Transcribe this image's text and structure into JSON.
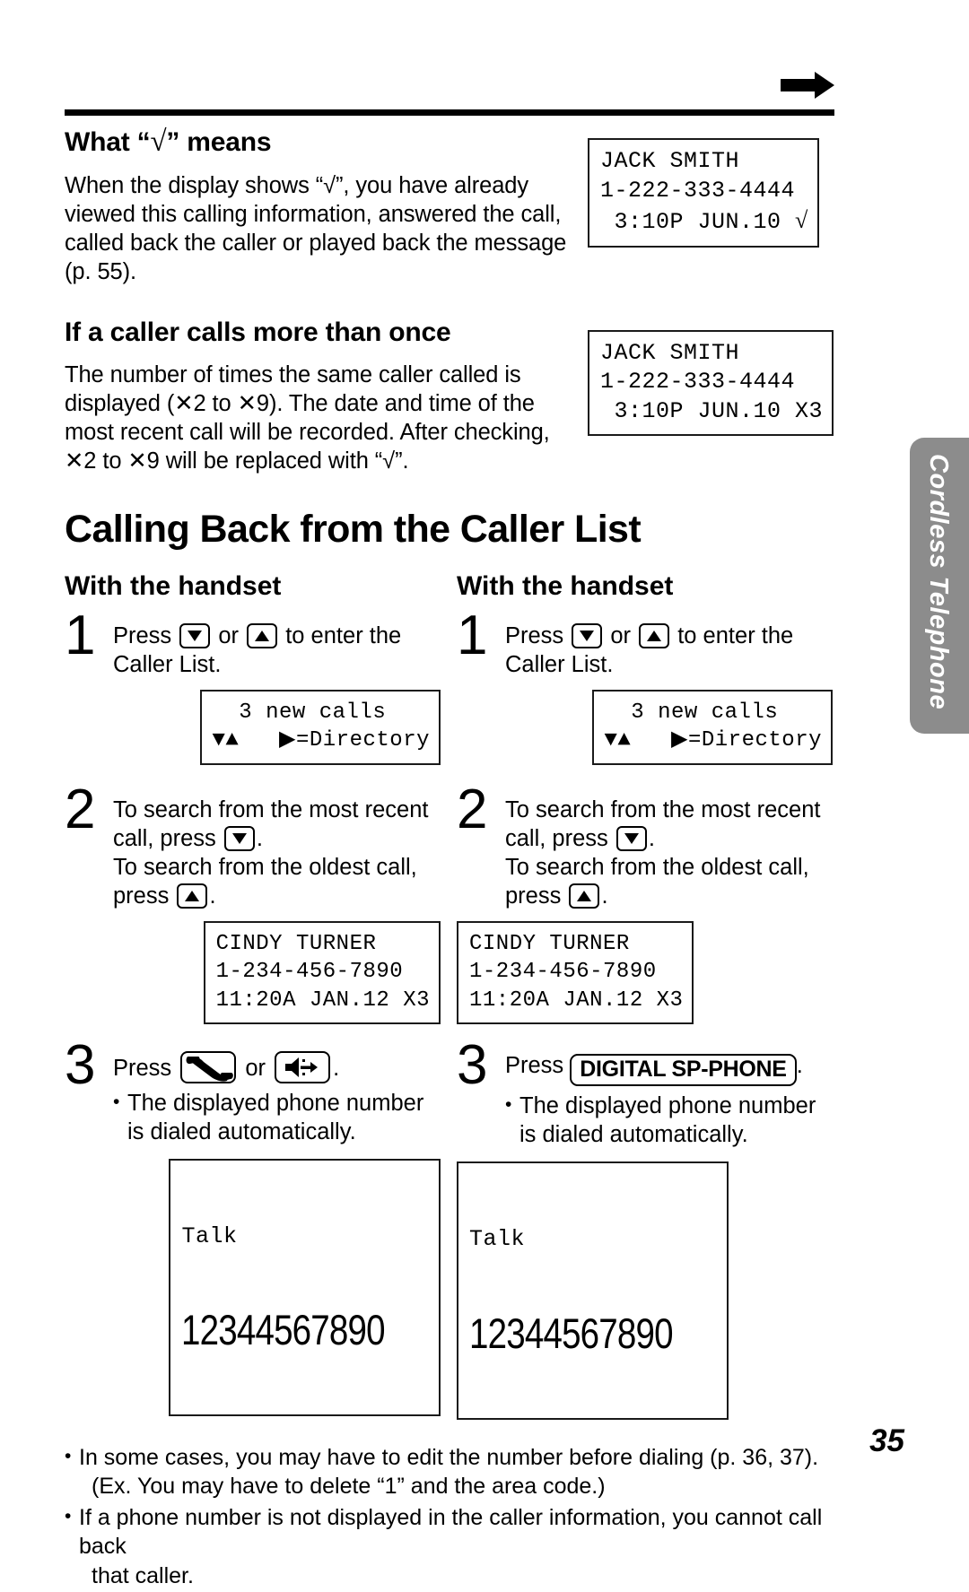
{
  "page": {
    "number": "35",
    "side_tab_label": "Cordless Telephone",
    "arrow_icon": "right-arrow-icon"
  },
  "section_check": {
    "heading_pre": "What “",
    "heading_symbol": "√",
    "heading_post": "” means",
    "body": "When the display shows “√”, you have already viewed this calling information, answered the call, called back the caller or played back the message (p. 55).",
    "lcd": {
      "line1": "JACK SMITH",
      "line2": "1-222-333-4444",
      "line3": " 3:10P JUN.10 ",
      "line3_symbol": "√"
    }
  },
  "section_multiple": {
    "heading": "If a caller calls more than once",
    "body": "The number of times the same caller called is displayed (✕2 to ✕9). The date and time of the most recent call will be recorded. After checking, ✕2 to ✕9 will be replaced with “√”.",
    "lcd": {
      "line1": "JACK SMITH",
      "line2": "1-222-333-4444",
      "line3": " 3:10P JUN.10 X3"
    }
  },
  "main_heading": "Calling Back from the Caller List",
  "columns": [
    {
      "subheading": "With the handset",
      "steps": [
        {
          "num": "1",
          "text_before": "Press ",
          "key1": "down-arrow-key",
          "text_mid": " or ",
          "key2": "up-arrow-key",
          "text_after": " to enter the Caller List.",
          "lcd": {
            "line1": "  3 new calls",
            "line2": "▼▲   ▶=Directory"
          }
        },
        {
          "num": "2",
          "text_before": "To search from the most recent call, press ",
          "key1": "down-arrow-key",
          "text_mid": ".",
          "text_before2": "To search from the oldest call, press ",
          "key2": "up-arrow-key",
          "text_after": ".",
          "lcd": {
            "line1": "CINDY TURNER",
            "line2": "1-234-456-7890",
            "line3": "11:20A JAN.12 X3"
          }
        },
        {
          "num": "3",
          "text_before": "Press ",
          "key1": "handset-key",
          "text_mid": " or ",
          "key2": "speakerphone-key",
          "text_after": ".",
          "bullet": "The displayed phone number is dialed automatically.",
          "lcd": {
            "line1": "Talk",
            "line2": "12344567890"
          }
        }
      ]
    },
    {
      "subheading": "With the handset",
      "steps": [
        {
          "num": "1",
          "text_before": "Press ",
          "key1": "down-arrow-key",
          "text_mid": " or ",
          "key2": "up-arrow-key",
          "text_after": " to enter the Caller List.",
          "lcd": {
            "line1": "  3 new calls",
            "line2": "▼▲   ▶=Directory"
          }
        },
        {
          "num": "2",
          "text_before": "To search from the most recent call, press ",
          "key1": "down-arrow-key",
          "text_mid": ".",
          "text_before2": "To search from the oldest call, press ",
          "key2": "up-arrow-key",
          "text_after": ".",
          "lcd": {
            "line1": "CINDY TURNER",
            "line2": "1-234-456-7890",
            "line3": "11:20A JAN.12 X3"
          }
        },
        {
          "num": "3",
          "text_before": "Press ",
          "button_label": "DIGITAL SP-PHONE",
          "text_after": ".",
          "bullet": "The displayed phone number is dialed automatically.",
          "lcd": {
            "line1": "Talk",
            "line2": "12344567890"
          }
        }
      ]
    }
  ],
  "notes": [
    {
      "text": "In some cases, you may have to edit the number before dialing (p. 36, 37).",
      "cont": "(Ex. You may have to delete “1” and the area code.)"
    },
    {
      "text": "If a phone number is not displayed in the caller information, you cannot call back",
      "cont": "that caller."
    }
  ]
}
